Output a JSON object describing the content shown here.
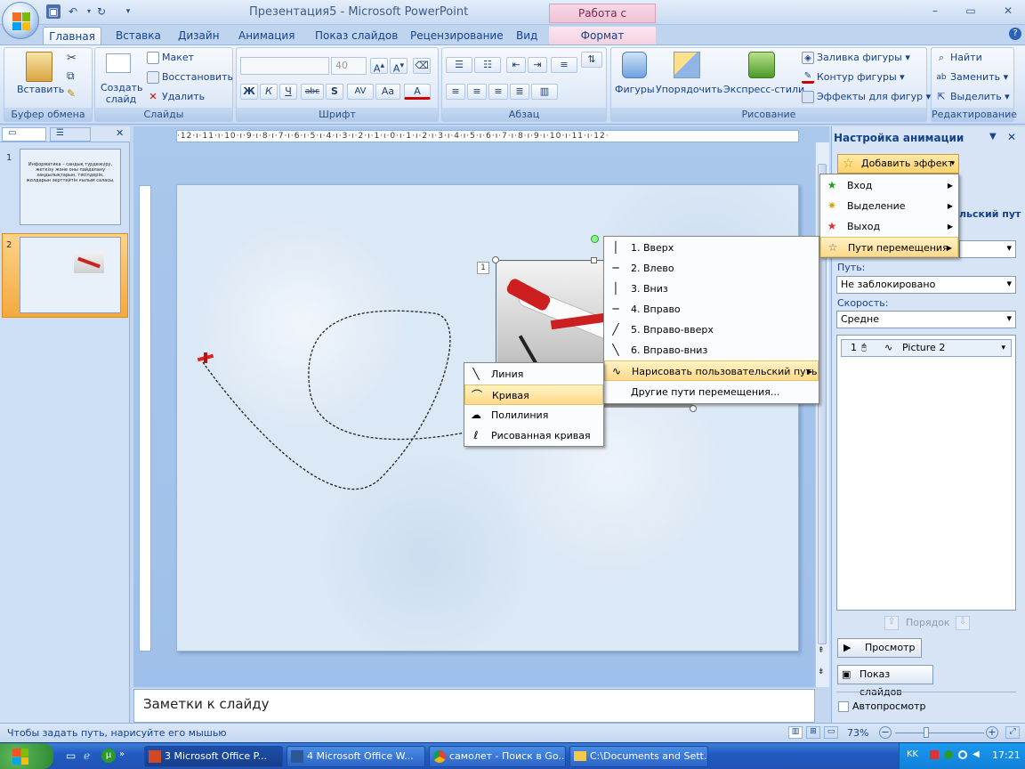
{
  "window": {
    "title": "Презентация5 - Microsoft PowerPoint",
    "context_tab_title": "Работа с рисунками"
  },
  "tabs": [
    "Главная",
    "Вставка",
    "Дизайн",
    "Анимация",
    "Показ слайдов",
    "Рецензирование",
    "Вид",
    "Формат"
  ],
  "ribbon": {
    "clipboard": {
      "paste": "Вставить",
      "label": "Буфер обмена"
    },
    "slides": {
      "new_slide": "Создать слайд",
      "layout": "Макет",
      "reset": "Восстановить",
      "delete": "Удалить",
      "label": "Слайды"
    },
    "font": {
      "size": "40",
      "label": "Шрифт",
      "bold": "Ж",
      "italic": "К",
      "underline": "Ч",
      "strike": "abc",
      "shadow": "S",
      "spacing": "AV",
      "case": "Aa",
      "color": "A"
    },
    "paragraph": {
      "label": "Абзац"
    },
    "drawing": {
      "shapes": "Фигуры",
      "arrange": "Упорядочить",
      "quick_styles": "Экспресс-стили",
      "fill": "Заливка фигуры",
      "outline": "Контур фигуры",
      "effects": "Эффекты для фигур",
      "label": "Рисование"
    },
    "editing": {
      "find": "Найти",
      "replace": "Заменить",
      "select": "Выделить",
      "label": "Редактирование"
    }
  },
  "slides_pane": {
    "slide1": {
      "number": "1",
      "text": "Информатика – сандық түрдежүру, жеткізу және оны пайдалану заңдылықтарын, тәсілдерін, жолдарын зерттейтін ғылым саласы."
    },
    "slide2": {
      "number": "2"
    }
  },
  "ruler": {
    "horizontal": "·12·ı·11·ı·10·ı·9·ı·8·ı·7·ı·6·ı·5·ı·4·ı·3·ı·2·ı·1·ı·0·ı·1·ı·2·ı·3·ı·4·ı·5·ı·6·ı·7·ı·8·ı·9·ı·10·ı·11·ı·12·"
  },
  "slide": {
    "animation_tag": "1"
  },
  "motion_paths_menu": [
    {
      "label": "1. Вверх",
      "icon": "line-vertical-icon"
    },
    {
      "label": "2. Влево",
      "icon": "line-horizontal-icon"
    },
    {
      "label": "3. Вниз",
      "icon": "line-vertical-icon"
    },
    {
      "label": "4. Вправо",
      "icon": "line-horizontal-icon"
    },
    {
      "label": "5. Вправо-вверх",
      "icon": "line-diagonal-up-icon"
    },
    {
      "label": "6. Вправо-вниз",
      "icon": "line-diagonal-down-icon"
    },
    {
      "label": "Нарисовать пользовательский путь",
      "icon": "custom-path-icon"
    },
    {
      "label": "Другие пути перемещения...",
      "icon": ""
    }
  ],
  "custom_path_menu": [
    {
      "label": "Линия",
      "icon": "line-tool-icon"
    },
    {
      "label": "Кривая",
      "icon": "curve-tool-icon",
      "highlighted": true
    },
    {
      "label": "Полилиния",
      "icon": "polyline-tool-icon"
    },
    {
      "label": "Рисованная кривая",
      "icon": "scribble-tool-icon"
    }
  ],
  "add_effect_menu": [
    {
      "label": "Вход",
      "icon": "star-green-icon"
    },
    {
      "label": "Выделение",
      "icon": "star-yellow-icon"
    },
    {
      "label": "Выход",
      "icon": "star-red-icon"
    },
    {
      "label": "Пути перемещения",
      "icon": "star-outline-icon",
      "highlighted": true
    }
  ],
  "taskpane": {
    "title": "Настройка анимации",
    "add_effect": "Добавить эффект",
    "partial_text": "льский пут",
    "path_label": "Путь:",
    "path_value": "Не заблокировано",
    "speed_label": "Скорость:",
    "speed_value": "Средне",
    "list_item": {
      "number": "1",
      "name": "Picture 2"
    },
    "order_label": "Порядок",
    "preview": "Просмотр",
    "slideshow": "Показ слайдов",
    "autopreview": "Автопросмотр"
  },
  "notes": {
    "placeholder": "Заметки к слайду"
  },
  "status": {
    "text": "Чтобы задать путь, нарисуйте его мышью",
    "zoom": "73%"
  },
  "taskbar": {
    "items": [
      "3 Microsoft Office P...",
      "4 Microsoft Office W...",
      "самолет - Поиск в Go...",
      "C:\\Documents and Sett..."
    ],
    "lang": "KK",
    "time": "17:21"
  },
  "colors": {
    "ribbon_blue": "#c4d7ee",
    "highlight": "#ffd98a",
    "context_tab": "#f0c2d5"
  }
}
